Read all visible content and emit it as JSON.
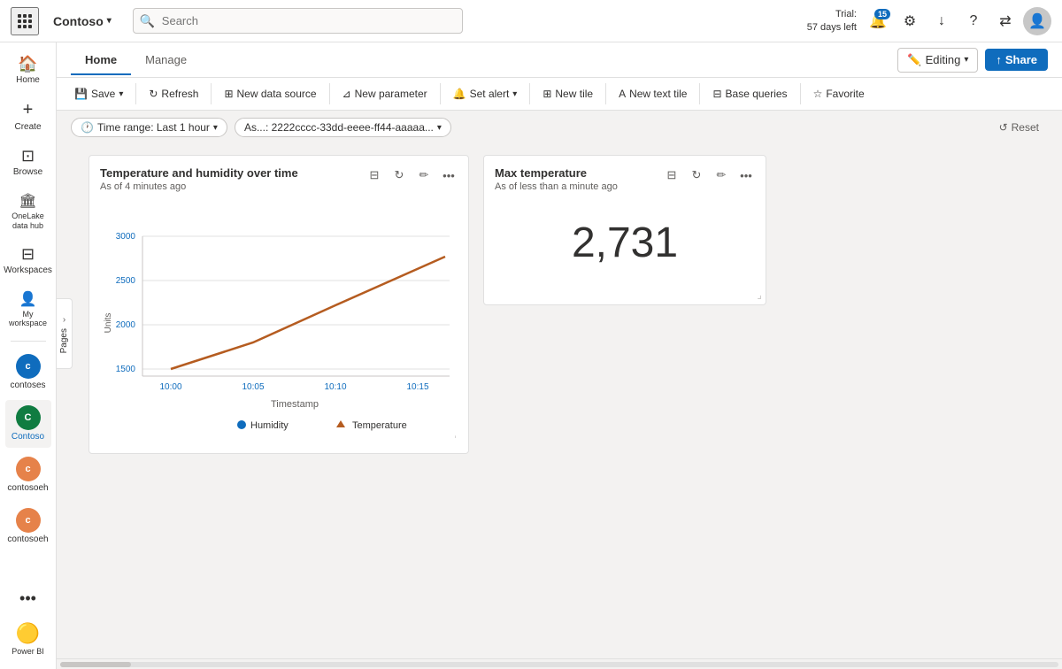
{
  "topbar": {
    "waffle_icon": "⋮⋮⋮",
    "brand_label": "Contoso",
    "brand_caret": "▾",
    "search_placeholder": "Search",
    "trial_line1": "Trial:",
    "trial_line2": "57 days left",
    "notif_count": "15",
    "settings_icon": "⚙",
    "download_icon": "↓",
    "help_icon": "?",
    "share_icon": "⇄",
    "avatar_icon": "👤"
  },
  "tabs": {
    "home_label": "Home",
    "manage_label": "Manage",
    "editing_label": "Editing",
    "share_label": "Share"
  },
  "toolbar": {
    "save_label": "Save",
    "refresh_label": "Refresh",
    "new_data_source_label": "New data source",
    "new_parameter_label": "New parameter",
    "set_alert_label": "Set alert",
    "new_tile_label": "New tile",
    "new_text_tile_label": "New text tile",
    "base_queries_label": "Base queries",
    "favorite_label": "Favorite"
  },
  "filters": {
    "time_range_label": "Time range: Last 1 hour",
    "asset_label": "As...: 2222cccc-33dd-eeee-ff44-aaaaa...",
    "reset_label": "Reset"
  },
  "pages_label": "Pages",
  "chart_card": {
    "title": "Temperature and humidity over time",
    "subtitle": "As of 4 minutes ago",
    "y_label": "Units",
    "x_label": "Timestamp",
    "x_ticks": [
      "10:00",
      "10:05",
      "10:10",
      "10:15"
    ],
    "y_ticks": [
      "3000",
      "2500",
      "2000",
      "1500"
    ],
    "legend": [
      {
        "color": "#0f6cbd",
        "label": "Humidity"
      },
      {
        "color": "#b55c20",
        "label": "Temperature"
      }
    ]
  },
  "kpi_card": {
    "title": "Max temperature",
    "subtitle": "As of less than a minute ago",
    "value": "2,731"
  },
  "sidebar": {
    "items": [
      {
        "icon": "⊞",
        "label": "Home"
      },
      {
        "icon": "+",
        "label": "Create"
      },
      {
        "icon": "🗂",
        "label": "Browse"
      },
      {
        "icon": "🏠",
        "label": "OneLake data hub"
      },
      {
        "icon": "⊡",
        "label": "Workspaces"
      },
      {
        "icon": "👤",
        "label": "My workspace"
      }
    ],
    "app_items": [
      {
        "label": "contoses",
        "bg": "#0f6cbd"
      },
      {
        "label": "Contoso",
        "bg": "#107c41",
        "active": true
      },
      {
        "label": "contosoeh",
        "bg": "#e6824a"
      },
      {
        "label": "contosoeh",
        "bg": "#e6824a"
      }
    ],
    "more_icon": "...",
    "powerbi_label": "Power BI"
  }
}
